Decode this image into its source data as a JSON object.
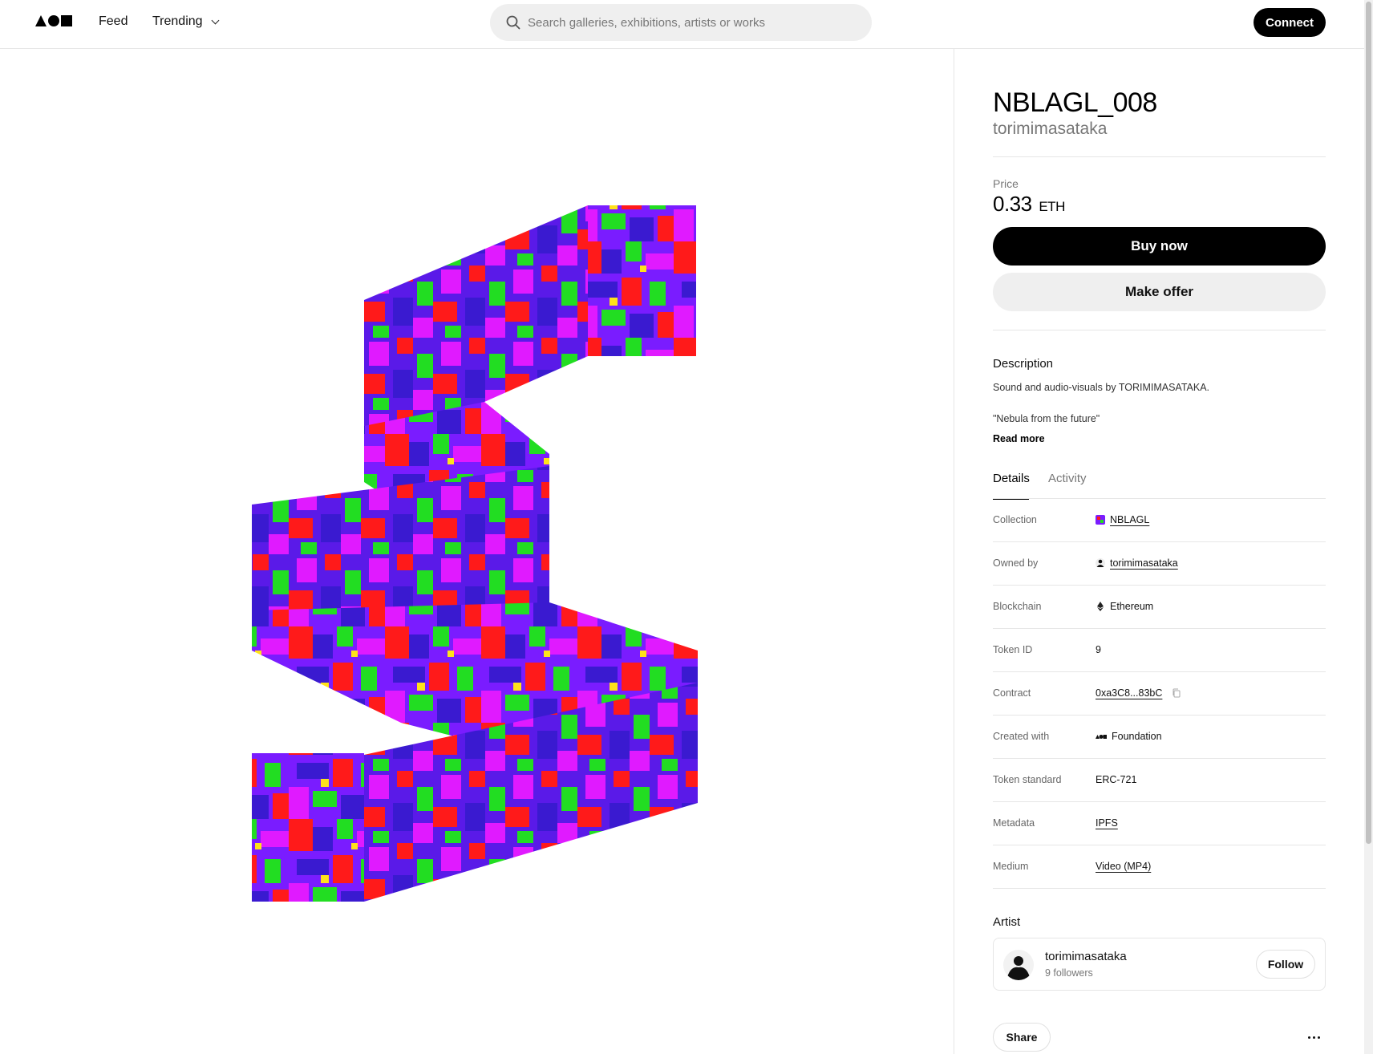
{
  "header": {
    "logo_label": "Foundation",
    "nav": {
      "feed": "Feed",
      "trending": "Trending"
    },
    "search": {
      "placeholder": "Search galleries, exhibitions, artists or works"
    },
    "connect_label": "Connect"
  },
  "artwork": {
    "title": "NBLAGL_008",
    "creator": "torimimasataka",
    "colors": {
      "purple": "#7a1cff",
      "red": "#ff1a1a",
      "green": "#22dd22",
      "magenta": "#e01aff",
      "blue": "#3a1ad0"
    }
  },
  "price": {
    "label": "Price",
    "amount": "0.33",
    "unit": "ETH"
  },
  "actions": {
    "buy_now": "Buy now",
    "make_offer": "Make offer"
  },
  "description": {
    "heading": "Description",
    "line1": "Sound and audio-visuals by TORIMIMASATAKA.",
    "line2": "\"Nebula from the future\"",
    "read_more": "Read more"
  },
  "tabs": {
    "details": "Details",
    "activity": "Activity"
  },
  "details": {
    "collection": {
      "label": "Collection",
      "value": "NBLAGL"
    },
    "owned_by": {
      "label": "Owned by",
      "value": "torimimasataka"
    },
    "blockchain": {
      "label": "Blockchain",
      "value": "Ethereum"
    },
    "token_id": {
      "label": "Token ID",
      "value": "9"
    },
    "contract": {
      "label": "Contract",
      "value": "0xa3C8...83bC"
    },
    "created_with": {
      "label": "Created with",
      "value": "Foundation"
    },
    "token_standard": {
      "label": "Token standard",
      "value": "ERC-721"
    },
    "metadata": {
      "label": "Metadata",
      "value": "IPFS"
    },
    "medium": {
      "label": "Medium",
      "value": "Video (MP4)"
    }
  },
  "artist": {
    "heading": "Artist",
    "name": "torimimasataka",
    "followers": "9 followers",
    "follow_label": "Follow"
  },
  "footer_actions": {
    "share": "Share"
  }
}
